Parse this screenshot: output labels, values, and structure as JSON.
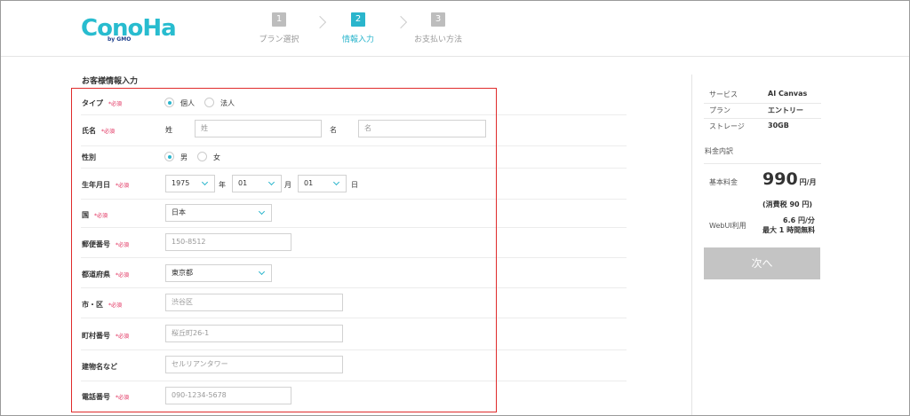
{
  "header": {
    "logo_text": "ConoHa",
    "logo_sub": "by GMO",
    "steps": [
      {
        "num": "1",
        "label": "プラン選択"
      },
      {
        "num": "2",
        "label": "情報入力"
      },
      {
        "num": "3",
        "label": "お支払い方法"
      }
    ]
  },
  "form": {
    "title": "お客様情報入力",
    "required": "*必須",
    "type": {
      "label": "タイプ",
      "opt_personal": "個人",
      "opt_corporate": "法人"
    },
    "name": {
      "label": "氏名",
      "last_label": "姓",
      "last_placeholder": "姓",
      "first_label": "名",
      "first_placeholder": "名"
    },
    "gender": {
      "label": "性別",
      "opt_male": "男",
      "opt_female": "女"
    },
    "birth": {
      "label": "生年月日",
      "year": "1975",
      "year_unit": "年",
      "month": "01",
      "month_unit": "月",
      "day": "01",
      "day_unit": "日"
    },
    "country": {
      "label": "国",
      "value": "日本"
    },
    "postal": {
      "label": "郵便番号",
      "placeholder": "150-8512"
    },
    "prefecture": {
      "label": "都道府県",
      "value": "東京都"
    },
    "city": {
      "label": "市・区",
      "placeholder": "渋谷区"
    },
    "town": {
      "label": "町村番号",
      "placeholder": "桜丘町26-1"
    },
    "building": {
      "label": "建物名など",
      "placeholder": "セルリアンタワー"
    },
    "phone": {
      "label": "電話番号",
      "placeholder": "090-1234-5678"
    }
  },
  "summary": {
    "service_label": "サービス",
    "service_value": "AI Canvas",
    "plan_label": "プラン",
    "plan_value": "エントリー",
    "storage_label": "ストレージ",
    "storage_value": "30GB",
    "breakdown_title": "料金内訳",
    "base_label": "基本料金",
    "base_price": "990",
    "base_unit": "円/月",
    "tax_note": "(消費税 90 円)",
    "webui_label": "WebUI利用",
    "webui_price": "6.6 円/分",
    "webui_note": "最大 1 時間無料",
    "next_button": "次へ"
  },
  "colors": {
    "accent": "#2ab5cc",
    "required": "#e02b5a",
    "highlight_border": "#e02b2b",
    "disabled_button": "#c4c4c4"
  }
}
